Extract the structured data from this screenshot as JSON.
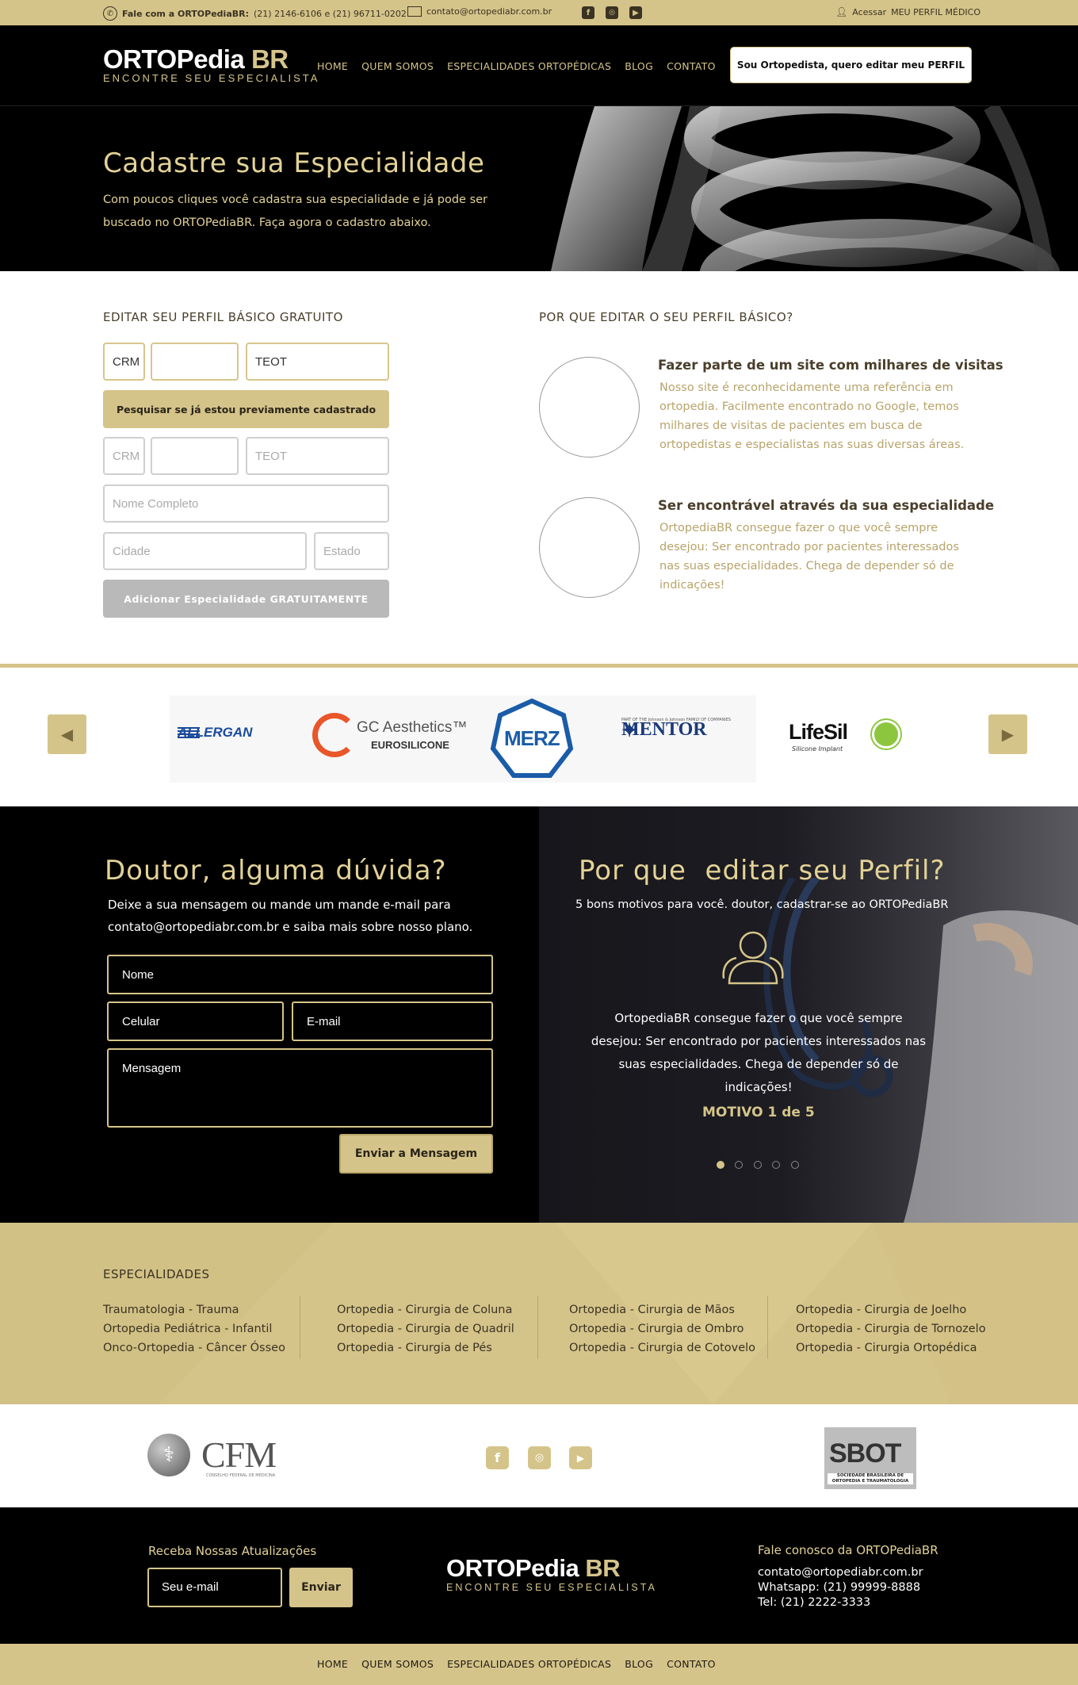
{
  "topbar": {
    "phone_label": "Fale com a ORTOPediaBR:",
    "phone_numbers": "(21) 2146-6106 e (21) 96711-0202",
    "email": "contato@ortopediabr.com.br",
    "social": [
      "f",
      "ig",
      "▶"
    ],
    "access_prefix": "Acessar",
    "access_link": "MEU PERFIL MÉDICO"
  },
  "logo": {
    "main": "ORTOPedia",
    "accent": "BR",
    "tagline": "ENCONTRE SEU ESPECIALISTA"
  },
  "nav": [
    "HOME",
    "QUEM SOMOS",
    "ESPECIALIDADES ORTOPÉDICAS",
    "BLOG",
    "CONTATO"
  ],
  "header_button": "Sou Ortopedista, quero editar meu PERFIL",
  "hero": {
    "title": "Cadastre sua Especialidade",
    "text": "Com poucos cliques você cadastra sua especialidade e já pode ser buscado no ORTOPediaBR. Faça agora o cadastro abaixo."
  },
  "form": {
    "title": "EDITAR SEU PERFIL BÁSICO GRATUITO",
    "crm_value": "CRM",
    "teot_value": "TEOT",
    "search_button": "Pesquisar se já estou previamente cadastrado",
    "crm_placeholder": "CRM",
    "teot_placeholder": "TEOT",
    "name_placeholder": "Nome Completo",
    "city_placeholder": "Cidade",
    "state_placeholder": "Estado",
    "add_button": "Adicionar Especialidade GRATUITAMENTE"
  },
  "why": {
    "title": "POR QUE EDITAR O SEU PERFIL BÁSICO?",
    "reasons": [
      {
        "title": "Fazer parte de um site com milhares de visitas",
        "text": "Nosso site é reconhecidamente uma referência em ortopedia. Facilmente encontrado no Google, temos milhares de visitas de pacientes em busca de ortopedistas e especialistas nas suas diversas áreas."
      },
      {
        "title": "Ser encontrável através da sua especialidade",
        "text": "OrtopediaBR consegue fazer o que você sempre desejou: Ser encontrado por pacientes interessados nas suas especialidades. Chega de depender só de indicações!"
      }
    ]
  },
  "carousel": {
    "brands": [
      "ALLERGAN",
      "GC Aesthetics™",
      "EUROSILICONE",
      "MERZ",
      "MENTOR",
      "PART OF THE Johnson & Johnson FAMILY OF COMPANIES",
      "LifeSil",
      "Silicone Implant"
    ]
  },
  "contact": {
    "title": "Doutor, alguma dúvida?",
    "text": "Deixe a sua mensagem ou mande um mande e-mail para contato@ortopediabr.com.br e saiba mais sobre nosso plano.",
    "name_placeholder": "Nome",
    "phone_placeholder": "Celular",
    "email_placeholder": "E-mail",
    "message_placeholder": "Mensagem",
    "send_button": "Enviar a Mensagem"
  },
  "motives": {
    "title": "Por que  editar seu Perfil?",
    "subtitle": "5 bons motivos para você. doutor, cadastrar-se ao ORTOPediaBR",
    "text": "OrtopediaBR consegue fazer o que você sempre desejou: Ser encontrado por pacientes interessados nas suas especialidades. Chega de depender só de indicações!",
    "counter": "MOTIVO 1 de 5",
    "active_dot": 1,
    "total_dots": 5
  },
  "specialties": {
    "title": "ESPECIALIDADES",
    "columns": [
      [
        "Traumatologia -  Trauma",
        "Ortopedia Pediátrica - Infantil",
        "Onco-Ortopedia - Câncer Ósseo"
      ],
      [
        "Ortopedia - Cirurgia de Coluna",
        "Ortopedia - Cirurgia de Quadril",
        "Ortopedia - Cirurgia de Pés"
      ],
      [
        "Ortopedia - Cirurgia de Mãos",
        "Ortopedia - Cirurgia de Ombro",
        "Ortopedia - Cirurgia de Cotovelo"
      ],
      [
        "Ortopedia - Cirurgia de Joelho",
        "Ortopedia - Cirurgia de Tornozelo",
        "Ortopedia - Cirurgia Ortopédica"
      ]
    ]
  },
  "partners": {
    "cfm": "CFM",
    "cfm_sub": "CONSELHO FEDERAL DE MEDICINA",
    "sbot": "SBOT",
    "sbot_sub": "SOCIEDADE BRASILEIRA DE ORTOPEDIA E TRAUMATOLOGIA"
  },
  "footer": {
    "newsletter_title": "Receba Nossas Atualizações",
    "email_placeholder": "Seu e-mail",
    "send_button": "Enviar",
    "contact_title": "Fale conosco da ORTOPediaBR",
    "contact_email": "contato@ortopediabr.com.br",
    "whatsapp": "Whatsapp: (21) 99999-8888",
    "tel": "Tel: (21) 2222-3333"
  },
  "colors": {
    "gold": "#d5c48a",
    "dark": "#000000",
    "text_gold": "#b8a36a"
  }
}
